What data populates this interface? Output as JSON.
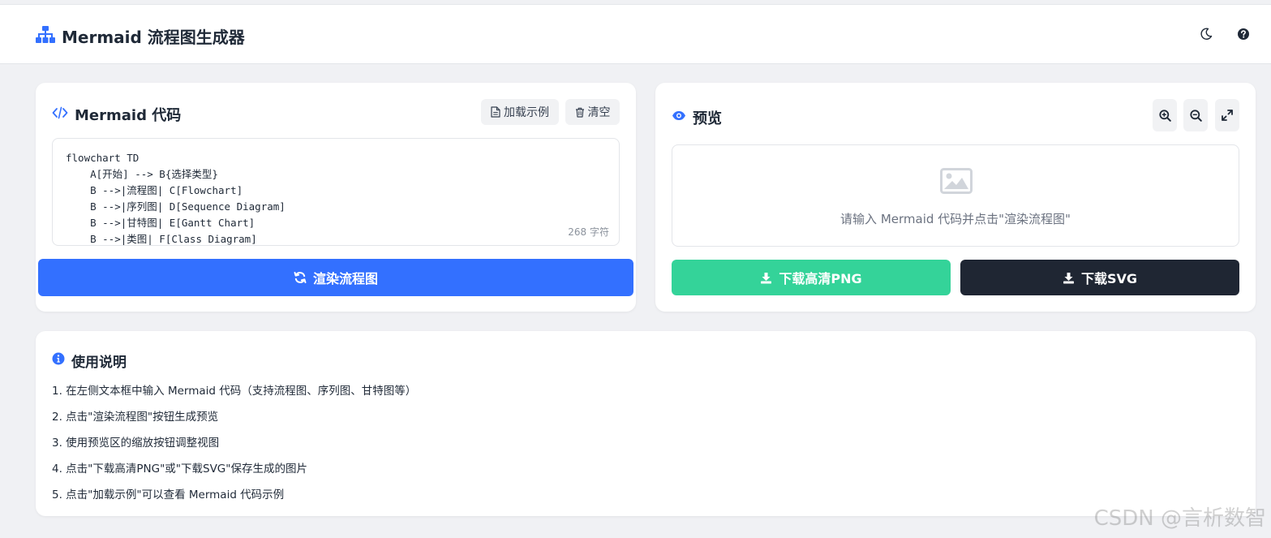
{
  "header": {
    "title": "Mermaid 流程图生成器",
    "theme_toggle_icon": "moon-icon",
    "help_icon": "question-circle-icon"
  },
  "code_panel": {
    "title": "Mermaid 代码",
    "load_example_label": "加载示例",
    "clear_label": "清空",
    "code_lines": [
      "flowchart TD",
      "    A[开始] --> B{选择类型}",
      "    B -->|流程图| C[Flowchart]",
      "    B -->|序列图| D[Sequence Diagram]",
      "    B -->|甘特图| E[Gantt Chart]",
      "    B -->|类图| F[Class Diagram]"
    ],
    "char_count": "268 字符",
    "render_label": "渲染流程图"
  },
  "preview_panel": {
    "title": "预览",
    "placeholder_text": "请输入 Mermaid 代码并点击\"渲染流程图\"",
    "download_png_label": "下载高清PNG",
    "download_svg_label": "下载SVG"
  },
  "instructions": {
    "title": "使用说明",
    "items": [
      "1. 在左侧文本框中输入 Mermaid 代码（支持流程图、序列图、甘特图等）",
      "2. 点击\"渲染流程图\"按钮生成预览",
      "3. 使用预览区的缩放按钮调整视图",
      "4. 点击\"下载高清PNG\"或\"下载SVG\"保存生成的图片",
      "5. 点击\"加载示例\"可以查看 Mermaid 代码示例"
    ]
  },
  "watermark": "CSDN @言析数智",
  "colors": {
    "primary": "#3370ff",
    "success": "#34d399",
    "dark": "#1f2937",
    "background": "#f0f1f4"
  }
}
